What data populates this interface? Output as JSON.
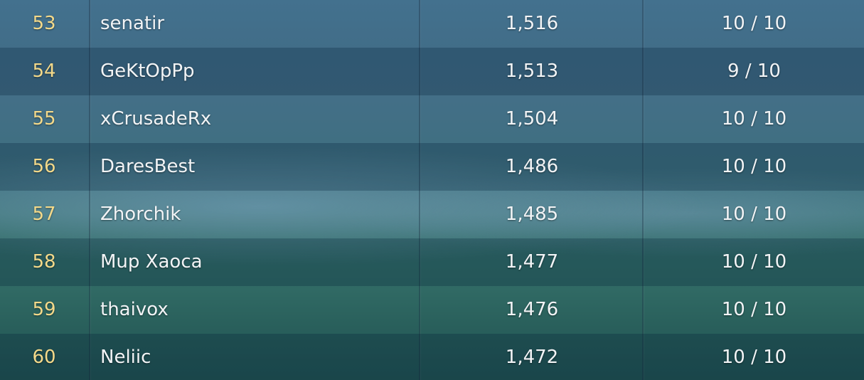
{
  "leaderboard": {
    "rows": [
      {
        "rank": "53",
        "name": "senatir",
        "rating": "1,516",
        "games": "10 / 10"
      },
      {
        "rank": "54",
        "name": "GeKtOpPp",
        "rating": "1,513",
        "games": "9 / 10"
      },
      {
        "rank": "55",
        "name": "xCrusadeRx",
        "rating": "1,504",
        "games": "10 / 10"
      },
      {
        "rank": "56",
        "name": "DaresBest",
        "rating": "1,486",
        "games": "10 / 10"
      },
      {
        "rank": "57",
        "name": "Zhorchik",
        "rating": "1,485",
        "games": "10 / 10"
      },
      {
        "rank": "58",
        "name": "Mup Xaoca",
        "rating": "1,477",
        "games": "10 / 10"
      },
      {
        "rank": "59",
        "name": "thaivox",
        "rating": "1,476",
        "games": "10 / 10"
      },
      {
        "rank": "60",
        "name": "Neliic",
        "rating": "1,472",
        "games": "10 / 10"
      }
    ]
  },
  "colors": {
    "rank_text": "#f3d98a",
    "body_text": "#f2f4f6"
  }
}
